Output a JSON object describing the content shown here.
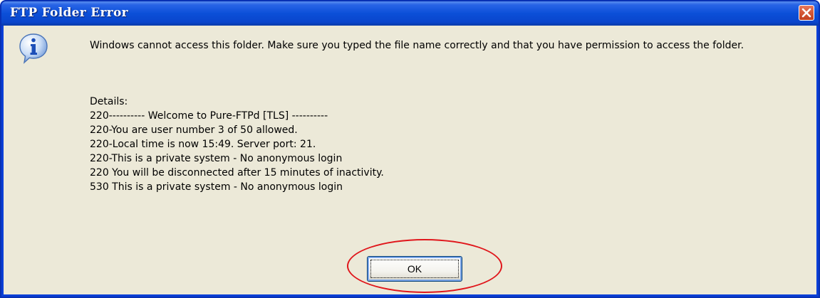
{
  "dialog": {
    "title": "FTP Folder Error",
    "message": "Windows cannot access this folder. Make sure you typed the file name correctly and that you have permission to access the folder.",
    "details_heading": "Details:",
    "details_lines": [
      "220---------- Welcome to Pure-FTPd [TLS] ----------",
      "220-You are user number 3 of 50 allowed.",
      "220-Local time is now 15:49. Server port: 21.",
      "220-This is a private system - No anonymous login",
      "220 You will be disconnected after 15 minutes of inactivity.",
      "530 This is a private system - No anonymous login"
    ],
    "ok_label": "OK",
    "icon": "info-icon",
    "close_icon": "close-icon"
  },
  "colors": {
    "titlebar": "#0b4fd8",
    "client_background": "#ece9d8",
    "close_button": "#d65a39",
    "annotation": "#e0161b"
  }
}
